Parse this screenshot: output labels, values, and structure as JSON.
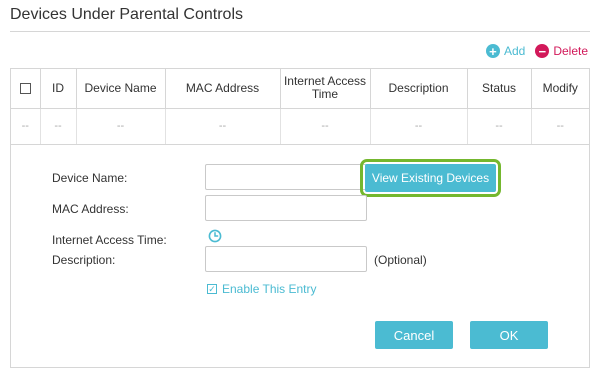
{
  "page": {
    "title": "Devices Under Parental Controls"
  },
  "toolbar": {
    "add_label": "Add",
    "add_icon": "plus-circle",
    "delete_label": "Delete",
    "delete_icon": "minus-circle",
    "add_color": "#4bbbd2",
    "delete_color": "#d2195a"
  },
  "table": {
    "headers": [
      "ID",
      "Device Name",
      "MAC Address",
      "Internet Access Time",
      "Description",
      "Status",
      "Modify"
    ],
    "empty_row": [
      "--",
      "--",
      "--",
      "--",
      "--",
      "--",
      "--",
      "--"
    ]
  },
  "form": {
    "device_name_label": "Device Name:",
    "device_name_value": "",
    "mac_address_label": "MAC Address:",
    "mac_address_value": "",
    "internet_access_time_label": "Internet Access Time:",
    "internet_access_time_icon": "clock",
    "description_label": "Description:",
    "description_value": "",
    "description_hint": "(Optional)",
    "view_existing_label": "View Existing Devices",
    "enable_entry_label": "Enable This Entry",
    "enable_entry_checked": true,
    "cancel_label": "Cancel",
    "ok_label": "OK"
  },
  "colors": {
    "accent": "#4bbbd2",
    "delete": "#d2195a",
    "highlight_ring": "#74b72e"
  }
}
